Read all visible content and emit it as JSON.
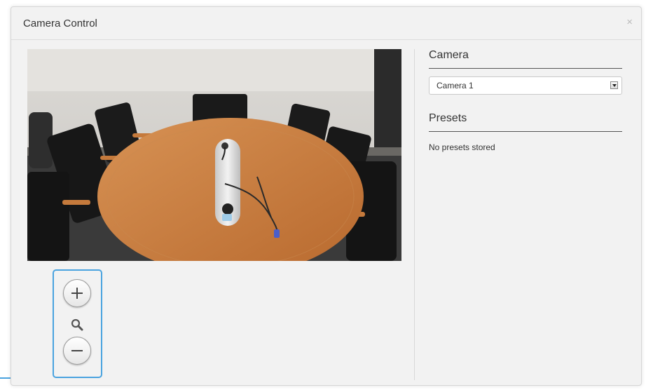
{
  "dialog": {
    "title": "Camera Control",
    "close_label": "×"
  },
  "camera": {
    "heading": "Camera",
    "selected": "Camera 1"
  },
  "presets": {
    "heading": "Presets",
    "empty_text": "No presets stored"
  },
  "zoom": {
    "in_icon": "plus-icon",
    "magnifier_icon": "magnifier-icon",
    "out_icon": "minus-icon"
  },
  "colors": {
    "accent": "#4aa3df",
    "panel": "#f2f2f2",
    "table": "#c97b3e"
  }
}
